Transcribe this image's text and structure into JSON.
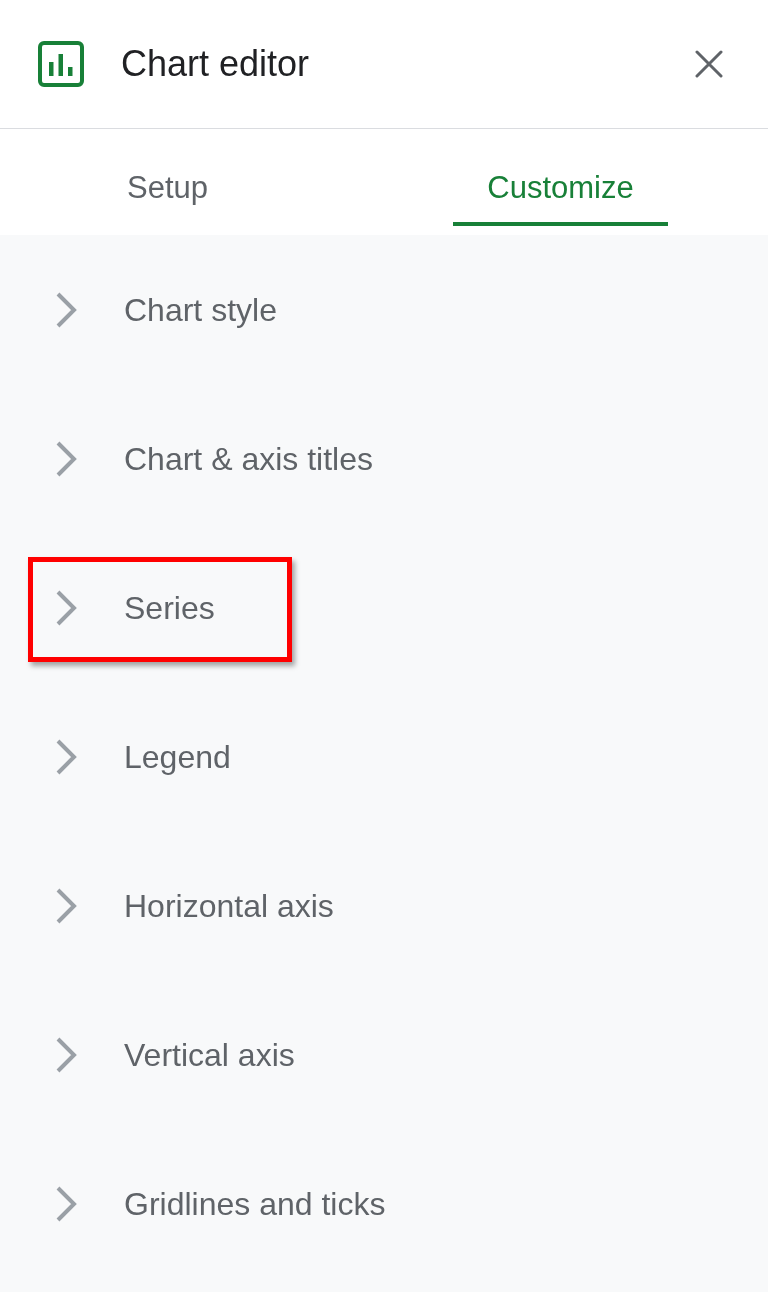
{
  "header": {
    "title": "Chart editor"
  },
  "tabs": [
    {
      "label": "Setup",
      "selected": false
    },
    {
      "label": "Customize",
      "selected": true
    }
  ],
  "sections": [
    {
      "label": "Chart style",
      "expanded": false,
      "highlighted": false
    },
    {
      "label": "Chart & axis titles",
      "expanded": false,
      "highlighted": false
    },
    {
      "label": "Series",
      "expanded": false,
      "highlighted": true
    },
    {
      "label": "Legend",
      "expanded": false,
      "highlighted": false
    },
    {
      "label": "Horizontal axis",
      "expanded": false,
      "highlighted": false
    },
    {
      "label": "Vertical axis",
      "expanded": false,
      "highlighted": false
    },
    {
      "label": "Gridlines and ticks",
      "expanded": false,
      "highlighted": false
    }
  ]
}
